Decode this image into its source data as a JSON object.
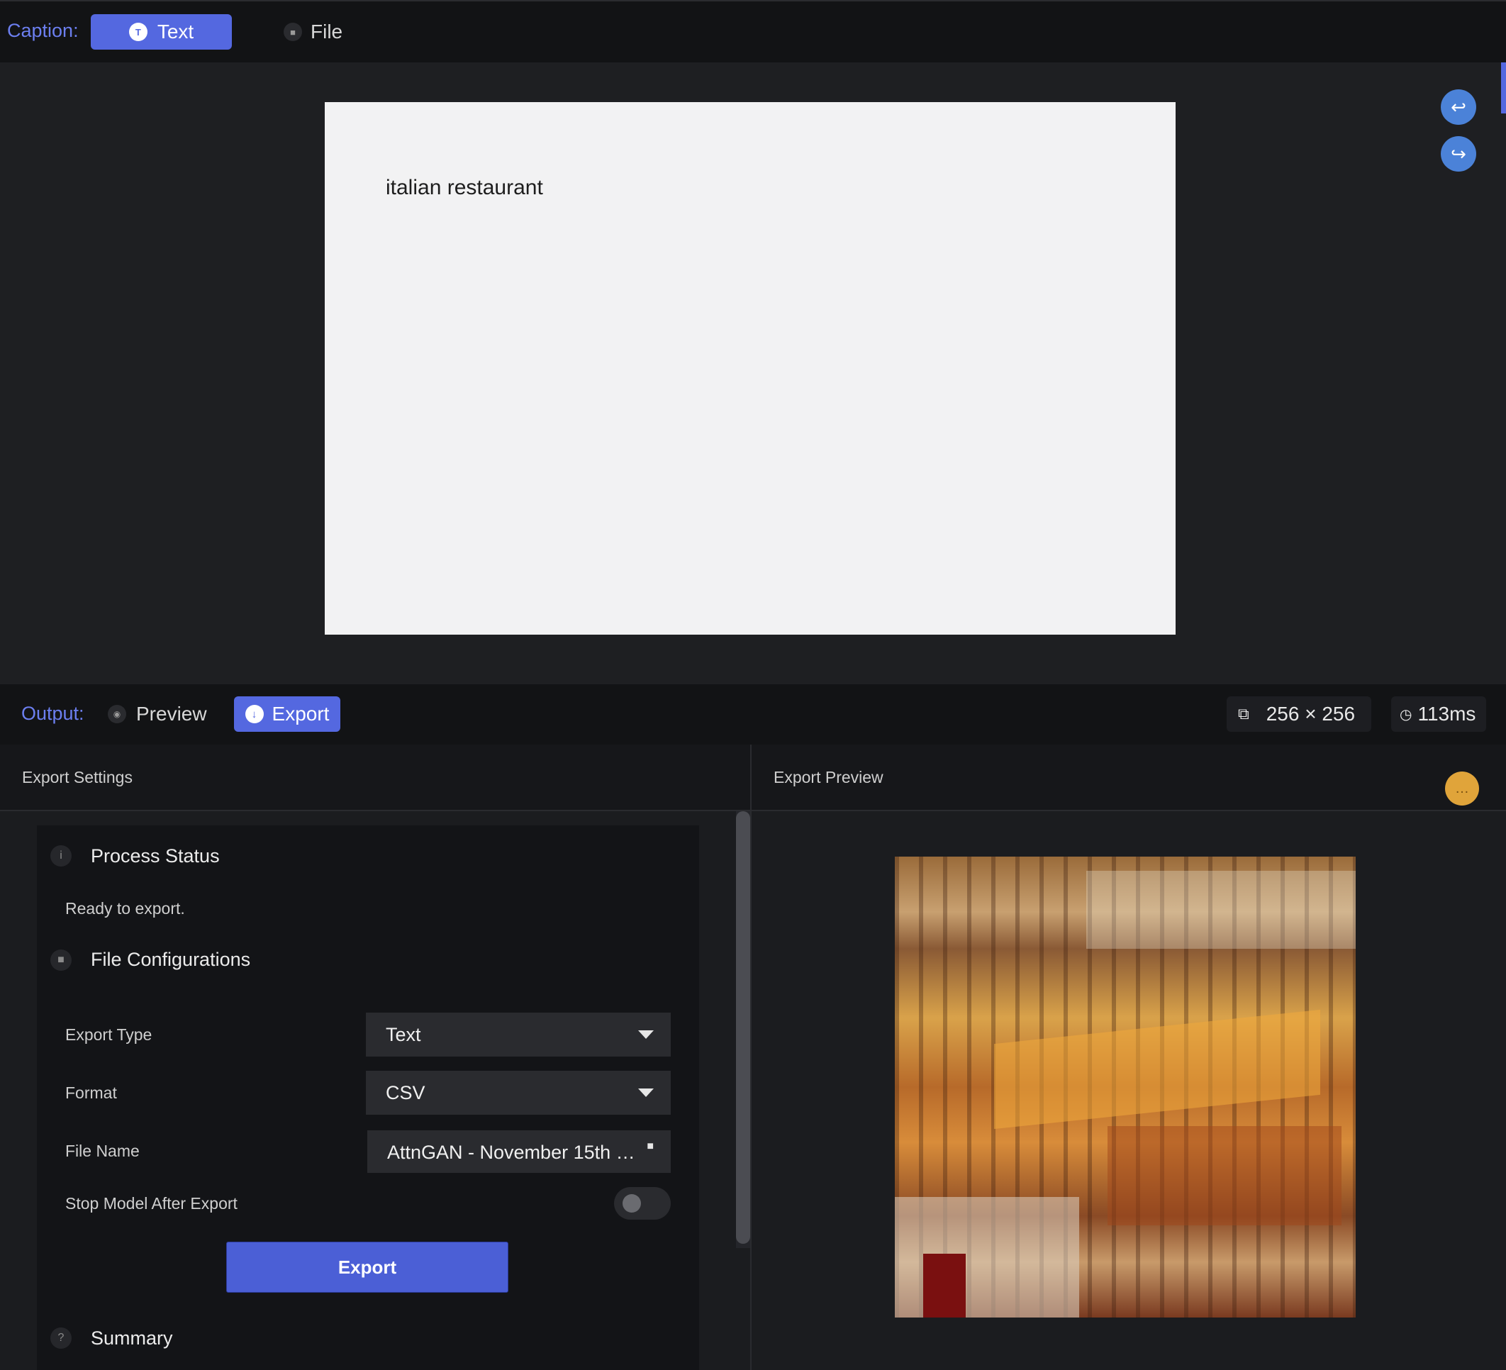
{
  "caption": {
    "label": "Caption:",
    "tabs": [
      {
        "label": "Text",
        "icon": "text-icon",
        "active": true
      },
      {
        "label": "File",
        "icon": "folder-icon",
        "active": false
      }
    ]
  },
  "canvas": {
    "text": "italian restaurant"
  },
  "side_buttons": {
    "undo_icon": "undo-icon",
    "redo_icon": "redo-icon"
  },
  "output": {
    "label": "Output:",
    "tabs": [
      {
        "label": "Preview",
        "icon": "eye-icon",
        "active": false
      },
      {
        "label": "Export",
        "icon": "download-icon",
        "active": true
      }
    ],
    "dimensions": "256 × 256",
    "duration": "113ms"
  },
  "export_settings": {
    "header": "Export Settings",
    "process_status": {
      "title": "Process Status",
      "message": "Ready to export."
    },
    "file_configurations": {
      "title": "File Configurations",
      "export_type_label": "Export Type",
      "export_type_value": "Text",
      "format_label": "Format",
      "format_value": "CSV",
      "file_name_label": "File Name",
      "file_name_value": "AttnGAN - November 15th …",
      "stop_model_label": "Stop Model After Export",
      "stop_model_enabled": false
    },
    "export_button": "Export",
    "summary_title": "Summary"
  },
  "export_preview": {
    "header": "Export Preview"
  },
  "colors": {
    "accent": "#5468e0",
    "accent_text": "#6c7ff0",
    "round_button": "#4b82d8",
    "chat_badge": "#e0a43a"
  }
}
